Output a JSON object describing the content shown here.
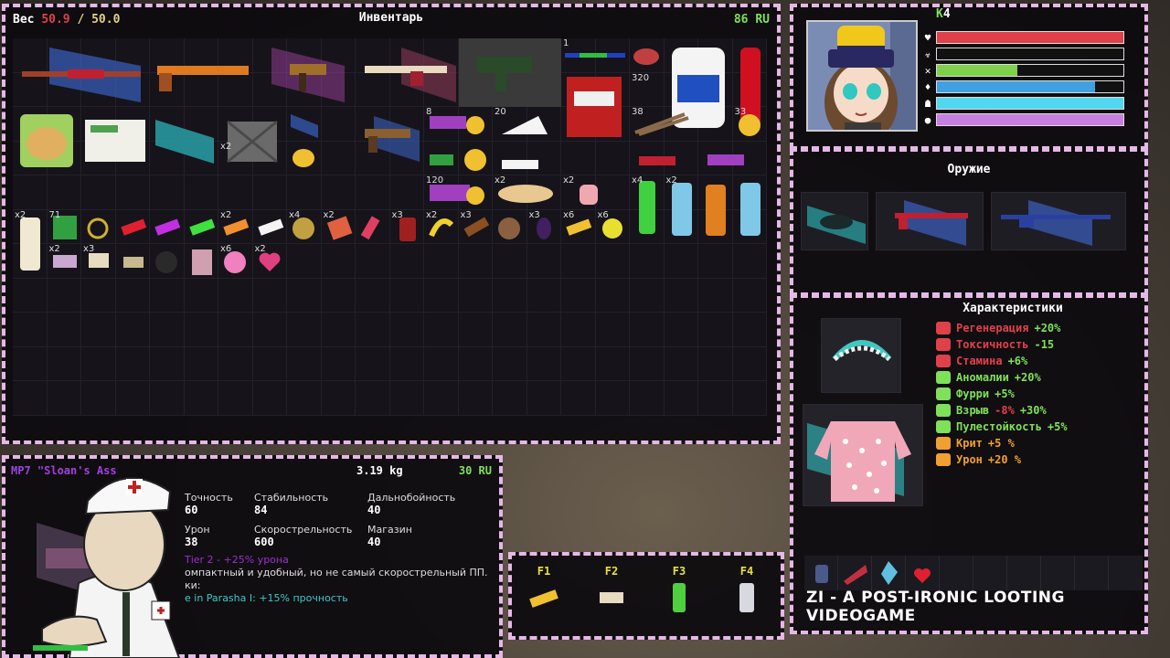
{
  "inventory": {
    "weight_label": "Вес",
    "weight_current": "50.9",
    "weight_separator": "/",
    "weight_max": "50.0",
    "title": "Инвентарь",
    "money": "86 RU",
    "counts": {
      "r0_c16": "1",
      "r1_c18": "320",
      "r2_c12": "8",
      "r2_c14": "20",
      "r2_c18": "38",
      "r2_c21": "33",
      "r3_c6": "x2",
      "r4_c12": "120",
      "r4_c14": "x2",
      "r4_c16": "x2",
      "r4_c18": "x4",
      "r4_c19": "x2",
      "r5_c0": "x2",
      "r5_c1": "71",
      "r5_c6": "x2",
      "r5_c8": "x4",
      "r5_c9": "x2",
      "r5_c11": "x3",
      "r5_c12": "x2",
      "r5_c13": "x3",
      "r5_c15": "x3",
      "r5_c16": "x6",
      "r5_c17": "x6",
      "r6_c1": "x2",
      "r6_c2": "x3",
      "r6_c6": "x6",
      "r6_c7": "x2"
    }
  },
  "player": {
    "kills_label": "K",
    "kills": "4",
    "bars": [
      {
        "icon": "heart-icon",
        "glyph": "♥",
        "fill": 1.0,
        "color": "#e0404a"
      },
      {
        "icon": "biohazard-icon",
        "glyph": "☣",
        "fill": 0.0,
        "color": "#a040e0"
      },
      {
        "icon": "stamina-icon",
        "glyph": "✕",
        "fill": 0.43,
        "color": "#7fd04a"
      },
      {
        "icon": "water-icon",
        "glyph": "♦",
        "fill": 0.85,
        "color": "#40a0e0"
      },
      {
        "icon": "run-icon",
        "glyph": "☗",
        "fill": 1.0,
        "color": "#50d8f0"
      },
      {
        "icon": "brain-icon",
        "glyph": "●",
        "fill": 1.0,
        "color": "#c880e0"
      }
    ]
  },
  "weapons": {
    "title": "Оружие"
  },
  "stats": {
    "title": "Характеристики",
    "rows": [
      {
        "label": "Регенерация",
        "value": "+20%",
        "label_color": "#e0404a",
        "value_color": "#7fe05a",
        "icon_color": "#e0404a"
      },
      {
        "label": "Токсичность",
        "value": "-15",
        "label_color": "#e0404a",
        "value_color": "#7fe05a",
        "icon_color": "#e0404a"
      },
      {
        "label": "Стамина",
        "value": "+6%",
        "label_color": "#e0404a",
        "value_color": "#7fe05a",
        "icon_color": "#e0404a"
      },
      {
        "label": "Аномалии",
        "value": "+20%",
        "label_color": "#7fe05a",
        "value_color": "#7fe05a",
        "icon_color": "#7fe05a"
      },
      {
        "label": "Фурри",
        "value": "+5%",
        "label_color": "#7fe05a",
        "value_color": "#7fe05a",
        "icon_color": "#7fe05a"
      },
      {
        "label": "Взрыв",
        "value": "-8%",
        "value2": "+30%",
        "label_color": "#7fe05a",
        "value_color": "#e0404a",
        "value2_color": "#7fe05a",
        "icon_color": "#7fe05a"
      },
      {
        "label": "Пулестойкость",
        "value": "+5%",
        "label_color": "#7fe05a",
        "value_color": "#7fe05a",
        "icon_color": "#7fe05a"
      },
      {
        "label": "Крит",
        "value": "+5 %",
        "label_color": "#f0a030",
        "value_color": "#f0a030",
        "icon_color": "#f0a030"
      },
      {
        "label": "Урон",
        "value": "+20 %",
        "label_color": "#f0a030",
        "value_color": "#f0a030",
        "icon_color": "#f0a030"
      }
    ],
    "footer": "ZI - A POST-IRONIC LOOTING VIDEOGAME"
  },
  "info": {
    "name": "MP7 \"Sloan's Ass",
    "weight": "3.19 kg",
    "price": "30 RU",
    "stats": [
      {
        "label": "Точность",
        "value": "60"
      },
      {
        "label": "Стабильность",
        "value": "84"
      },
      {
        "label": "Дальнобойность",
        "value": "40"
      },
      {
        "label": "Урон",
        "value": "38"
      },
      {
        "label": "Скорострельность",
        "value": "600"
      },
      {
        "label": "Магазин",
        "value": "40"
      }
    ],
    "tier": "Тier 2 - +25% урона",
    "desc": "омпактный и удобный, но не самый скорострельный ПП.",
    "desc2": "ки:",
    "mod": "e in Parasha I: +15% прочность"
  },
  "hotbar": {
    "keys": [
      "F1",
      "F2",
      "F3",
      "F4"
    ]
  }
}
